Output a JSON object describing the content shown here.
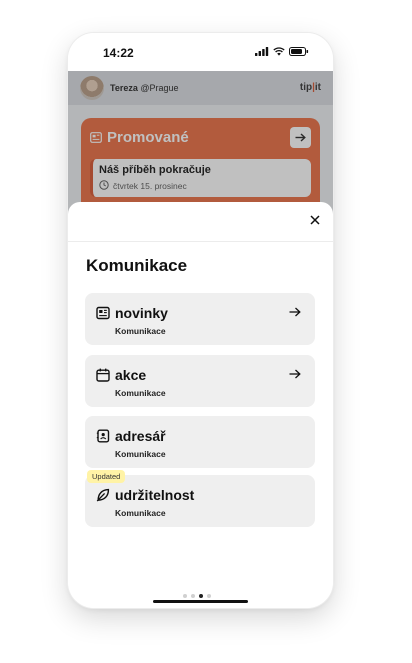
{
  "status_bar": {
    "time": "14:22"
  },
  "background_app": {
    "user_name": "Tereza",
    "user_location": "@Prague",
    "logo_part1": "tip",
    "logo_bar": "|",
    "logo_part2": "it",
    "promo_title": "Promované",
    "promo_item_title": "Náš příběh pokračuje",
    "promo_item_date": "čtvrtek 15. prosinec"
  },
  "sheet": {
    "title": "Komunikace",
    "items": [
      {
        "label": "novinky",
        "subtitle": "Komunikace",
        "icon": "newspaper-icon",
        "has_arrow": true
      },
      {
        "label": "akce",
        "subtitle": "Komunikace",
        "icon": "calendar-icon",
        "has_arrow": true
      },
      {
        "label": "adresář",
        "subtitle": "Komunikace",
        "icon": "address-book-icon",
        "has_arrow": false
      },
      {
        "label": "udržitelnost",
        "subtitle": "Komunikace",
        "icon": "leaf-icon",
        "has_arrow": false,
        "badge": "Updated"
      }
    ]
  },
  "colors": {
    "accent": "#ea6b3e",
    "badge": "#fff3a6",
    "item_bg": "#efefef"
  }
}
